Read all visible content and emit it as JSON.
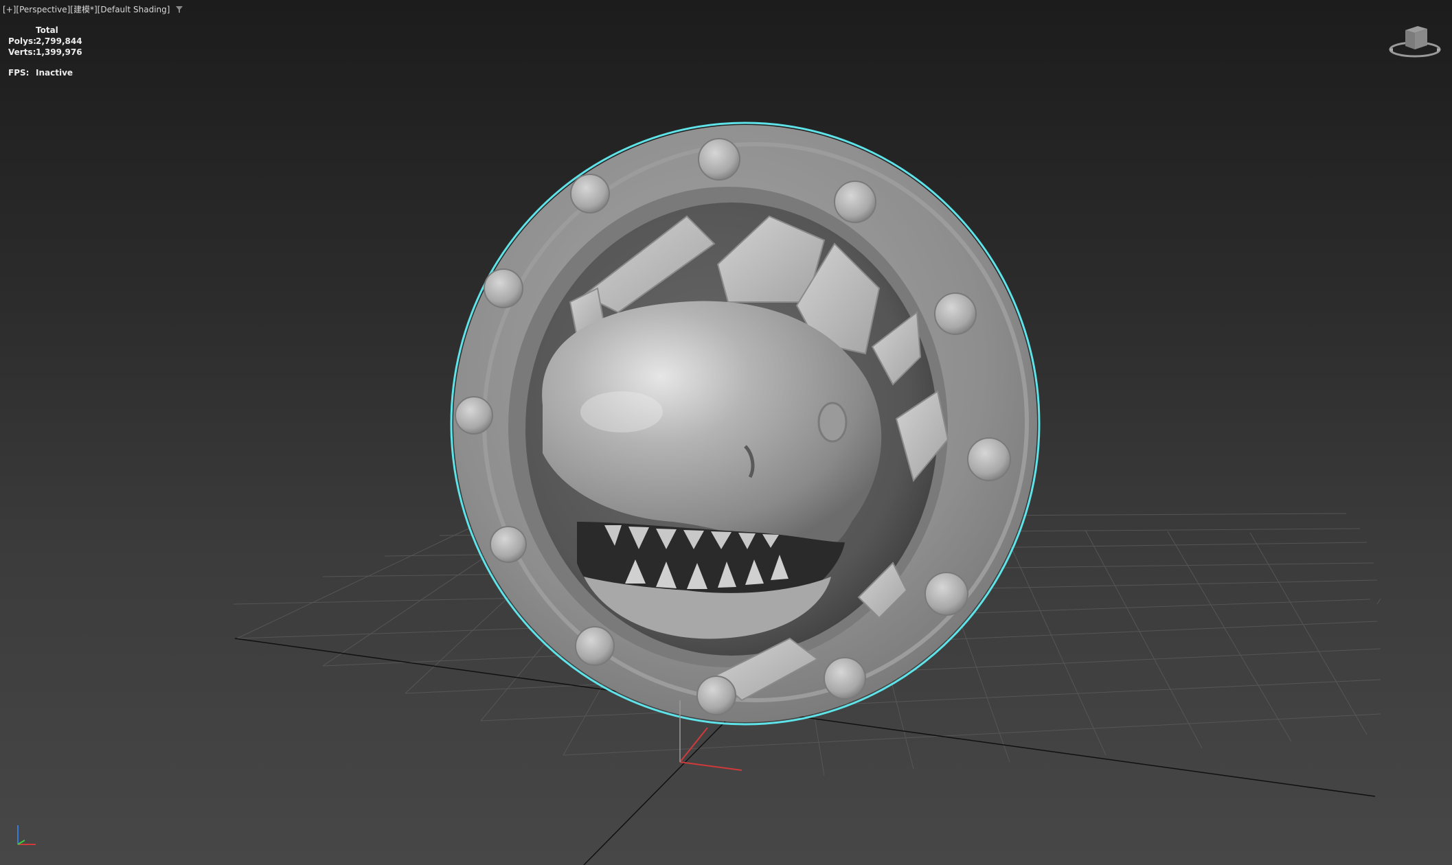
{
  "viewport": {
    "label_parts": [
      "[+]",
      "[Perspective]",
      "[建模*]",
      "[Default Shading]"
    ],
    "filter_icon": "filter-icon"
  },
  "stats": {
    "header": "Total",
    "polys_label": "Polys:",
    "polys_value": "2,799,844",
    "verts_label": "Verts:",
    "verts_value": "1,399,976",
    "fps_label": "FPS:",
    "fps_value": "Inactive"
  },
  "scene": {
    "object": "porthole-shark-model",
    "selection_outline_color": "#5fe3e8",
    "grid_color": "#5a5a5a",
    "grid_axis_color": "#101010"
  },
  "colors": {
    "background_top": "#1c1c1c",
    "background_bottom": "#474747",
    "text": "#e0e0e0"
  },
  "icons": {
    "viewcube": "viewcube-icon",
    "axis_tripod": "axis-tripod-icon"
  }
}
